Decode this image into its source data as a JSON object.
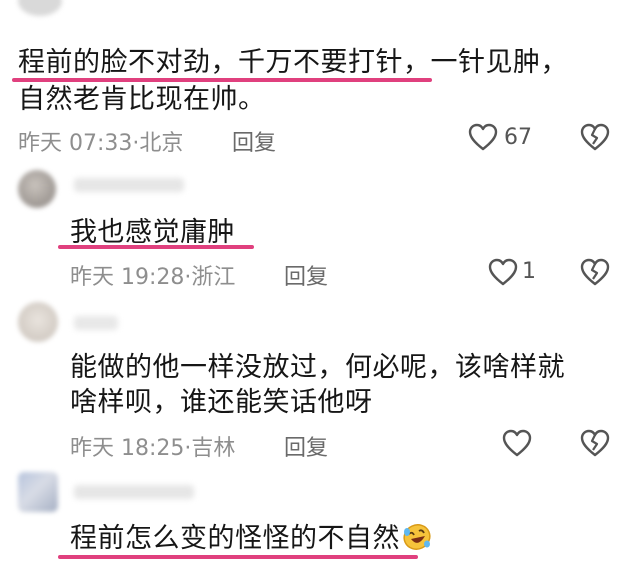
{
  "comments": [
    {
      "lines": [
        "程前的脸不对劲，千万不要打针，一针见肿，",
        "自然老肯比现在帅。"
      ],
      "time": "昨天 07:33",
      "location": "北京",
      "reply_label": "回复",
      "likes": "67"
    },
    {
      "lines": [
        "我也感觉庸肿"
      ],
      "time": "昨天 19:28",
      "location": "浙江",
      "reply_label": "回复",
      "likes": "1"
    },
    {
      "lines": [
        "能做的他一样没放过，何必呢，该啥样就",
        "啥样呗，谁还能笑话他呀"
      ],
      "time": "昨天 18:25",
      "location": "吉林",
      "reply_label": "回复",
      "likes": ""
    },
    {
      "lines": [
        "程前怎么变的怪怪的不自然"
      ],
      "emoji": "rofl-emoji"
    }
  ],
  "colors": {
    "highlight_underline": "#e0407e",
    "meta_text": "#8e8e8e"
  },
  "icons": {
    "like": "heart-outline-icon",
    "dislike": "broken-heart-icon"
  }
}
